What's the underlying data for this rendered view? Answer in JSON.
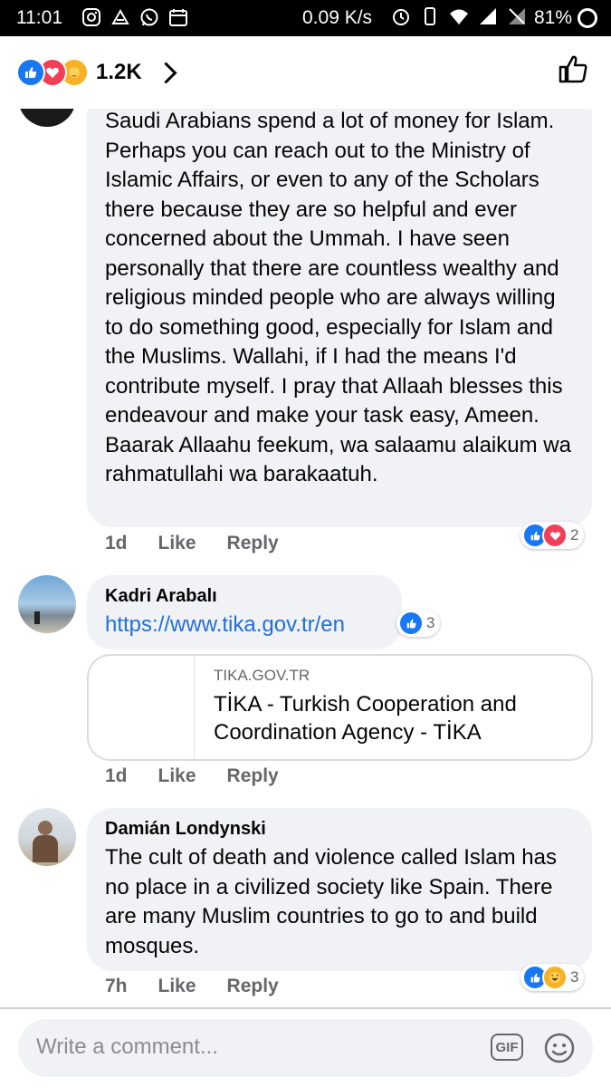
{
  "status_bar": {
    "time": "11:01",
    "network_speed": "0.09 K/s",
    "battery": "81%"
  },
  "header": {
    "reaction_count": "1.2K",
    "reaction_icons": [
      "like-icon",
      "love-icon",
      "care-icon"
    ]
  },
  "comments": [
    {
      "author": "",
      "text": "Saudi Arabians spend a lot of money for Islam. Perhaps you can reach out to the Ministry of Islamic Affairs, or even to any of the Scholars there because they are so helpful and ever concerned about the Ummah. I have seen personally that there are countless wealthy and religious minded people who are always willing to do something good, especially for Islam and the Muslims. Wallahi, if I had the means I'd contribute myself. I pray that Allaah blesses this endeavour and make your task easy, Ameen. Baarak Allaahu feekum, wa salaamu alaikum wa rahmatullahi wa barakaatuh.",
      "time": "1d",
      "like_label": "Like",
      "reply_label": "Reply",
      "reaction_count": "2",
      "reaction_icons": [
        "like-icon",
        "love-icon"
      ]
    },
    {
      "author": "Kadri Arabalı",
      "link": "https://www.tika.gov.tr/en",
      "reaction_count": "3",
      "reaction_icons": [
        "like-icon"
      ],
      "link_preview": {
        "domain": "TIKA.GOV.TR",
        "title": "TİKA - Turkish Cooperation and Coordination Agency - TİKA"
      },
      "time": "1d",
      "like_label": "Like",
      "reply_label": "Reply"
    },
    {
      "author": "Damián Londynski",
      "text": "The cult of death and violence called Islam has no place in a civilized society like Spain. There are many Muslim countries to go to and build mosques.",
      "time": "7h",
      "like_label": "Like",
      "reply_label": "Reply",
      "reaction_count": "3",
      "reaction_icons": [
        "like-icon",
        "haha-icon"
      ]
    }
  ],
  "composer": {
    "placeholder": "Write a comment...",
    "gif_label": "GIF"
  },
  "colors": {
    "accent": "#1877f2",
    "link": "#216fdb",
    "bubble": "#f0f2f5",
    "meta_text": "#65676b"
  }
}
